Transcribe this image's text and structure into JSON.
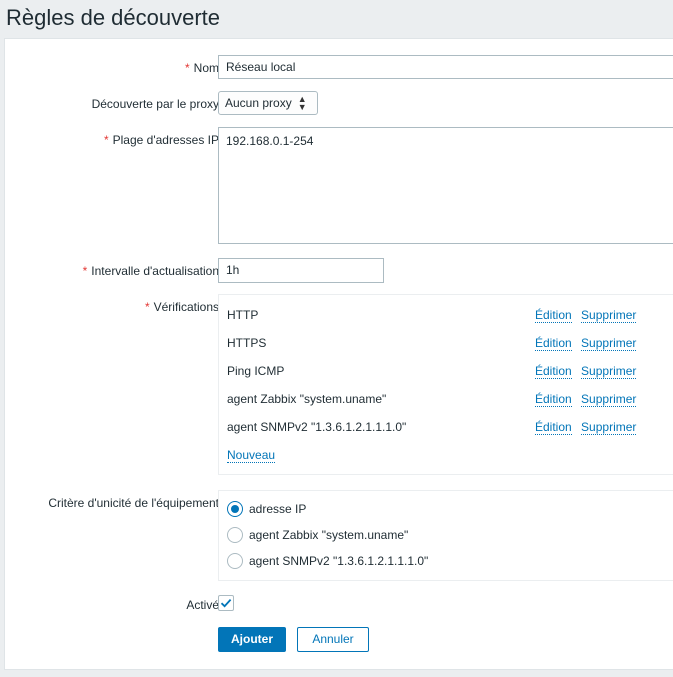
{
  "page": {
    "title": "Règles de découverte"
  },
  "form": {
    "name": {
      "required": "*",
      "label": "Nom",
      "value": "Réseau local"
    },
    "proxy": {
      "label": "Découverte par le proxy",
      "selected": "Aucun proxy"
    },
    "ip_range": {
      "required": "*",
      "label": "Plage d'adresses IP",
      "value": "192.168.0.1-254"
    },
    "interval": {
      "required": "*",
      "label": "Intervalle d'actualisation",
      "value": "1h"
    },
    "checks": {
      "required": "*",
      "label": "Vérifications",
      "edit_label": "Édition",
      "remove_label": "Supprimer",
      "items": [
        {
          "name": "HTTP"
        },
        {
          "name": "HTTPS"
        },
        {
          "name": "Ping ICMP"
        },
        {
          "name": "agent Zabbix \"system.uname\""
        },
        {
          "name": "agent SNMPv2 \"1.3.6.1.2.1.1.1.0\""
        }
      ],
      "new_label": "Nouveau"
    },
    "uniqueness": {
      "label": "Critère d'unicité de l'équipement",
      "options": [
        {
          "label": "adresse IP",
          "selected": true
        },
        {
          "label": "agent Zabbix \"system.uname\"",
          "selected": false
        },
        {
          "label": "agent SNMPv2 \"1.3.6.1.2.1.1.1.0\"",
          "selected": false
        }
      ]
    },
    "enabled": {
      "label": "Activé",
      "checked": true
    },
    "buttons": {
      "add": "Ajouter",
      "cancel": "Annuler"
    }
  },
  "colors": {
    "accent": "#0275b8",
    "required": "#e33734",
    "background": "#ebeef0"
  }
}
